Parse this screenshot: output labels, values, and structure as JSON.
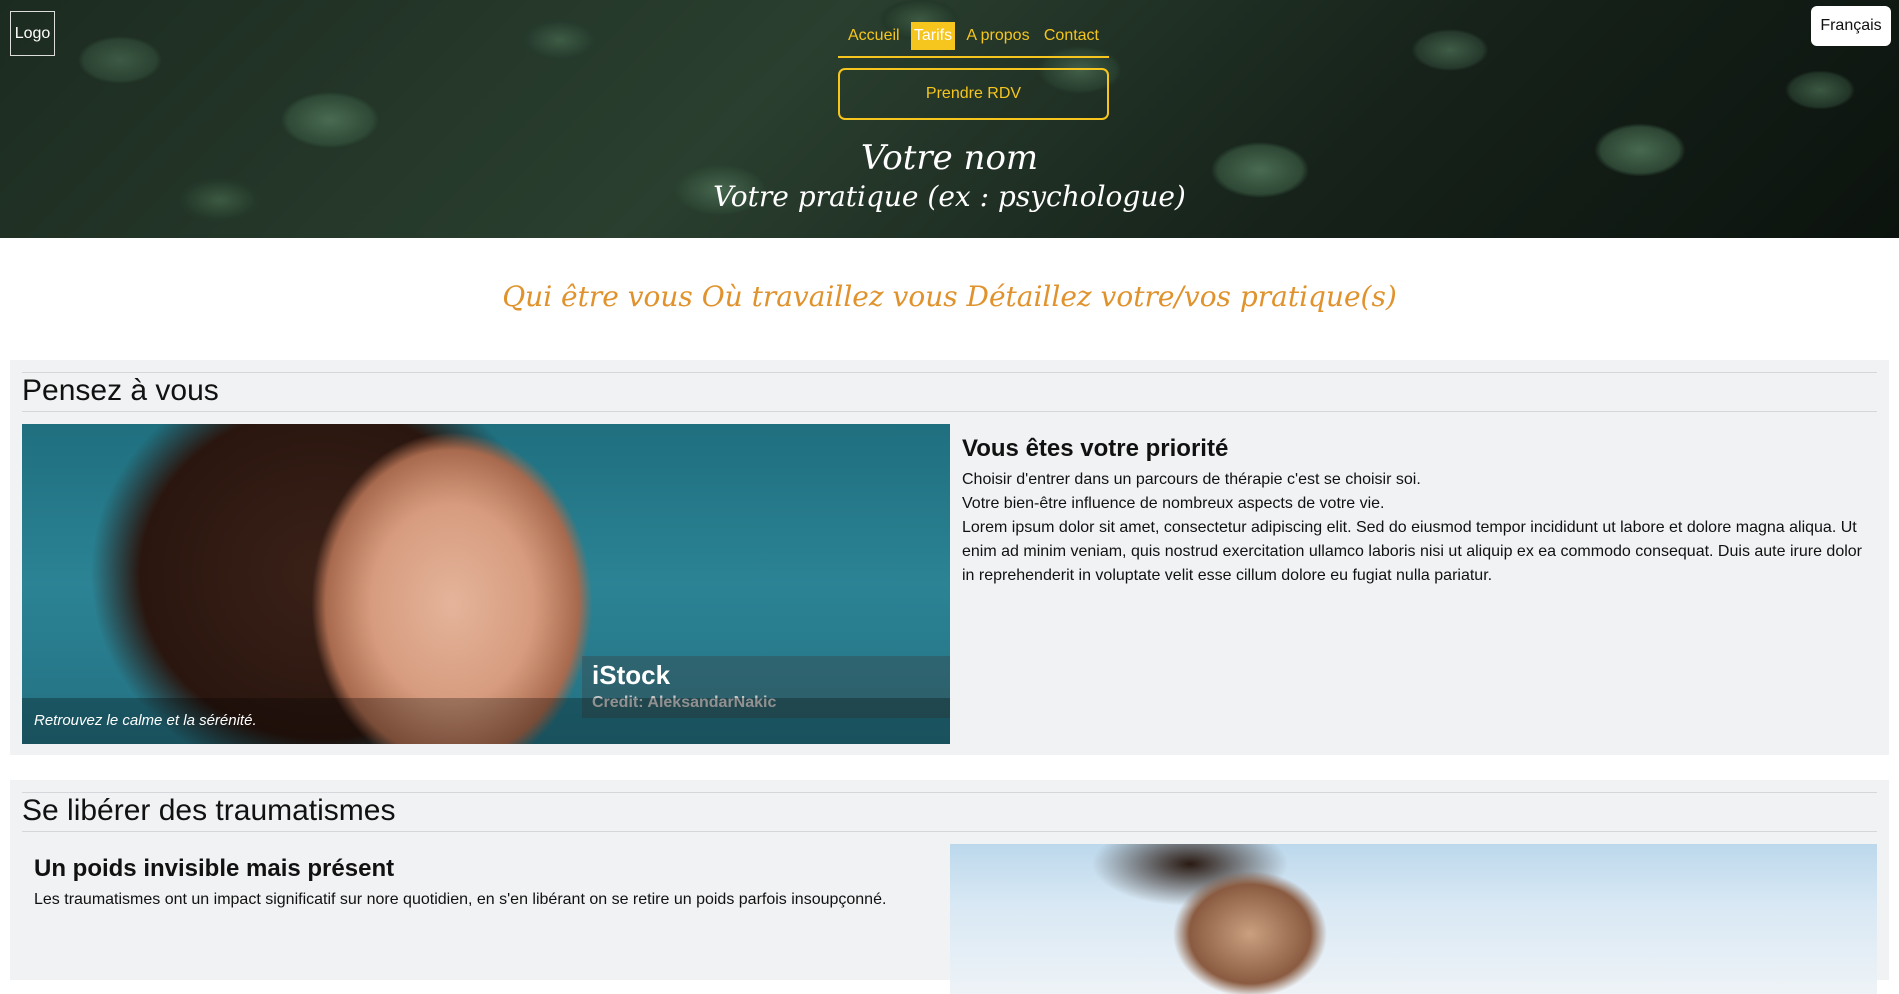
{
  "header": {
    "logo": "Logo",
    "language": "Français",
    "nav": [
      "Accueil",
      "Tarifs",
      "A propos",
      "Contact"
    ],
    "active_nav": "Tarifs",
    "cta": "Prendre RDV",
    "name": "Votre nom",
    "practice": "Votre pratique (ex : psychologue)"
  },
  "tagline": "Qui être vous Où travaillez vous Détaillez votre/vos pratique(s)",
  "sections": [
    {
      "title": "Pensez à vous",
      "image_caption": "Retrouvez le calme et la sérénité.",
      "watermark_brand": "iStock",
      "watermark_credit": "Credit: AleksandarNakic",
      "subtitle": "Vous êtes votre priorité",
      "paragraphs": [
        "Choisir d'entrer dans un parcours de thérapie c'est se choisir soi.",
        "Votre bien-être influence de nombreux aspects de votre vie.",
        "Lorem ipsum dolor sit amet, consectetur adipiscing elit. Sed do eiusmod tempor incididunt ut labore et dolore magna aliqua. Ut enim ad minim veniam, quis nostrud exercitation ullamco laboris nisi ut aliquip ex ea commodo consequat. Duis aute irure dolor in reprehenderit in voluptate velit esse cillum dolore eu fugiat nulla pariatur."
      ]
    },
    {
      "title": "Se libérer des traumatismes",
      "subtitle": "Un poids invisible mais présent",
      "paragraphs": [
        "Les traumatismes ont un impact significatif sur nore quotidien, en s'en libérant on se retire un poids parfois insoupçonné."
      ]
    }
  ],
  "colors": {
    "accent": "#f6c51e",
    "tagline": "#e0922c",
    "section_bg": "#f1f2f4"
  }
}
